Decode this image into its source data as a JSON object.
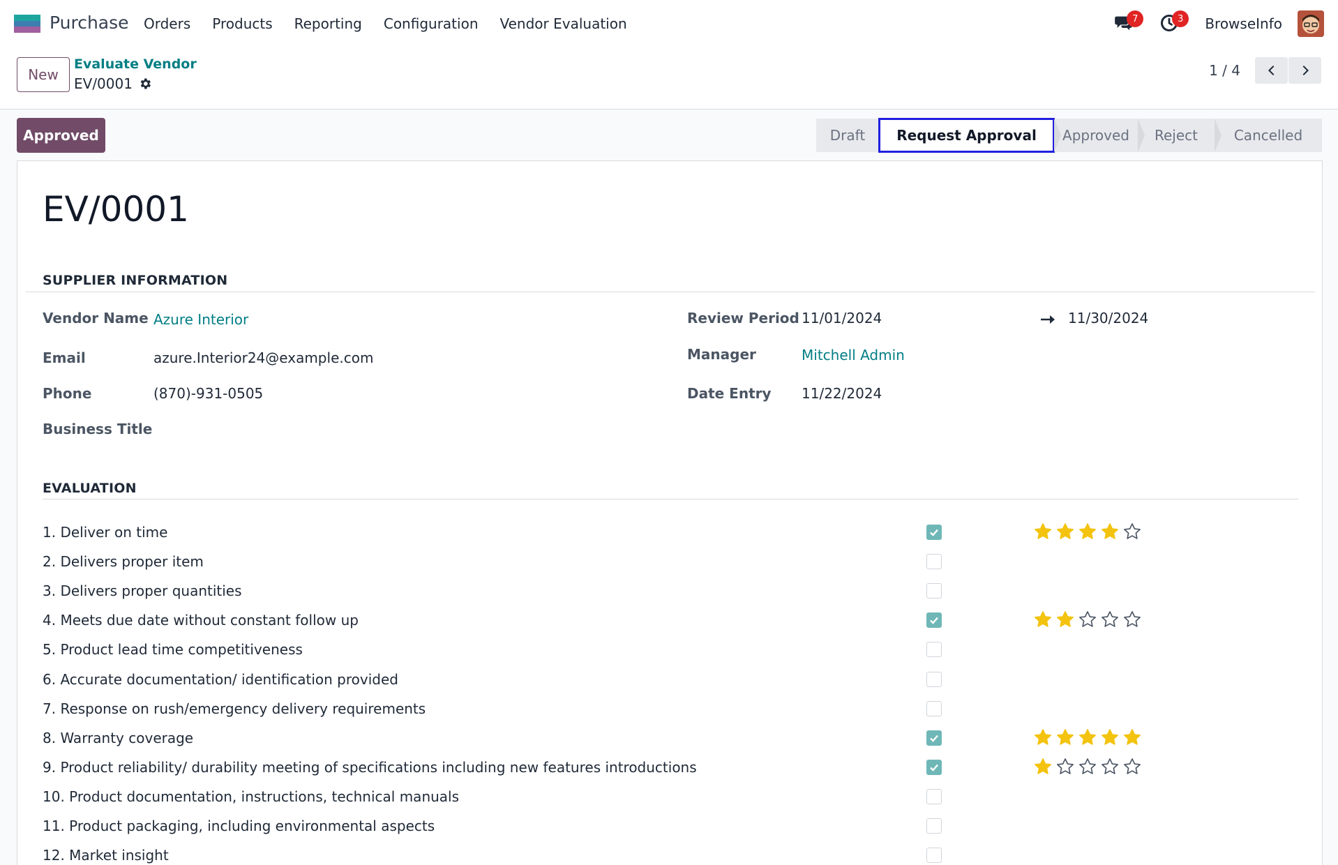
{
  "topbar": {
    "app_name": "Purchase",
    "menu": [
      "Orders",
      "Products",
      "Reporting",
      "Configuration",
      "Vendor Evaluation"
    ],
    "messages_count": "7",
    "activities_count": "3",
    "company": "BrowseInfo"
  },
  "control": {
    "new_label": "New",
    "breadcrumb_parent": "Evaluate Vendor",
    "breadcrumb_current": "EV/0001",
    "pager": "1 / 4"
  },
  "status": {
    "action_button": "Approved",
    "stages": [
      "Draft",
      "Request Approval",
      "Approved",
      "Reject",
      "Cancelled"
    ],
    "active_stage": "Request Approval"
  },
  "record": {
    "title": "EV/0001",
    "supplier_section": "SUPPLIER INFORMATION",
    "vendor_name_label": "Vendor Name",
    "vendor_name": "Azure Interior",
    "email_label": "Email",
    "email": "azure.Interior24@example.com",
    "phone_label": "Phone",
    "phone": "(870)-931-0505",
    "business_title_label": "Business Title",
    "review_period_label": "Review Period",
    "review_start": "11/01/2024",
    "review_end": "11/30/2024",
    "manager_label": "Manager",
    "manager": "Mitchell Admin",
    "date_entry_label": "Date Entry",
    "date_entry": "11/22/2024",
    "evaluation_section": "EVALUATION"
  },
  "evaluation": [
    {
      "label": "1. Deliver on time",
      "checked": true,
      "rating": 4
    },
    {
      "label": "2. Delivers proper item",
      "checked": false,
      "rating": 0
    },
    {
      "label": "3. Delivers proper quantities",
      "checked": false,
      "rating": 0
    },
    {
      "label": "4. Meets due date without constant follow up",
      "checked": true,
      "rating": 2
    },
    {
      "label": "5. Product lead time competitiveness",
      "checked": false,
      "rating": 0
    },
    {
      "label": "6. Accurate documentation/ identification provided",
      "checked": false,
      "rating": 0
    },
    {
      "label": "7. Response on rush/emergency delivery requirements",
      "checked": false,
      "rating": 0
    },
    {
      "label": "8. Warranty coverage",
      "checked": true,
      "rating": 5
    },
    {
      "label": "9. Product reliability/ durability meeting of specifications including new features introductions",
      "checked": true,
      "rating": 1
    },
    {
      "label": "10. Product documentation, instructions, technical manuals",
      "checked": false,
      "rating": 0
    },
    {
      "label": "11. Product packaging, including environmental aspects",
      "checked": false,
      "rating": 0
    },
    {
      "label": "12. Market insight",
      "checked": false,
      "rating": 0
    }
  ],
  "colors": {
    "brand": "#714b67",
    "link": "#017e84",
    "star_filled": "#f3c30f",
    "checkbox_on": "#6fb7b7",
    "focus_outline": "#1f1fe0"
  }
}
